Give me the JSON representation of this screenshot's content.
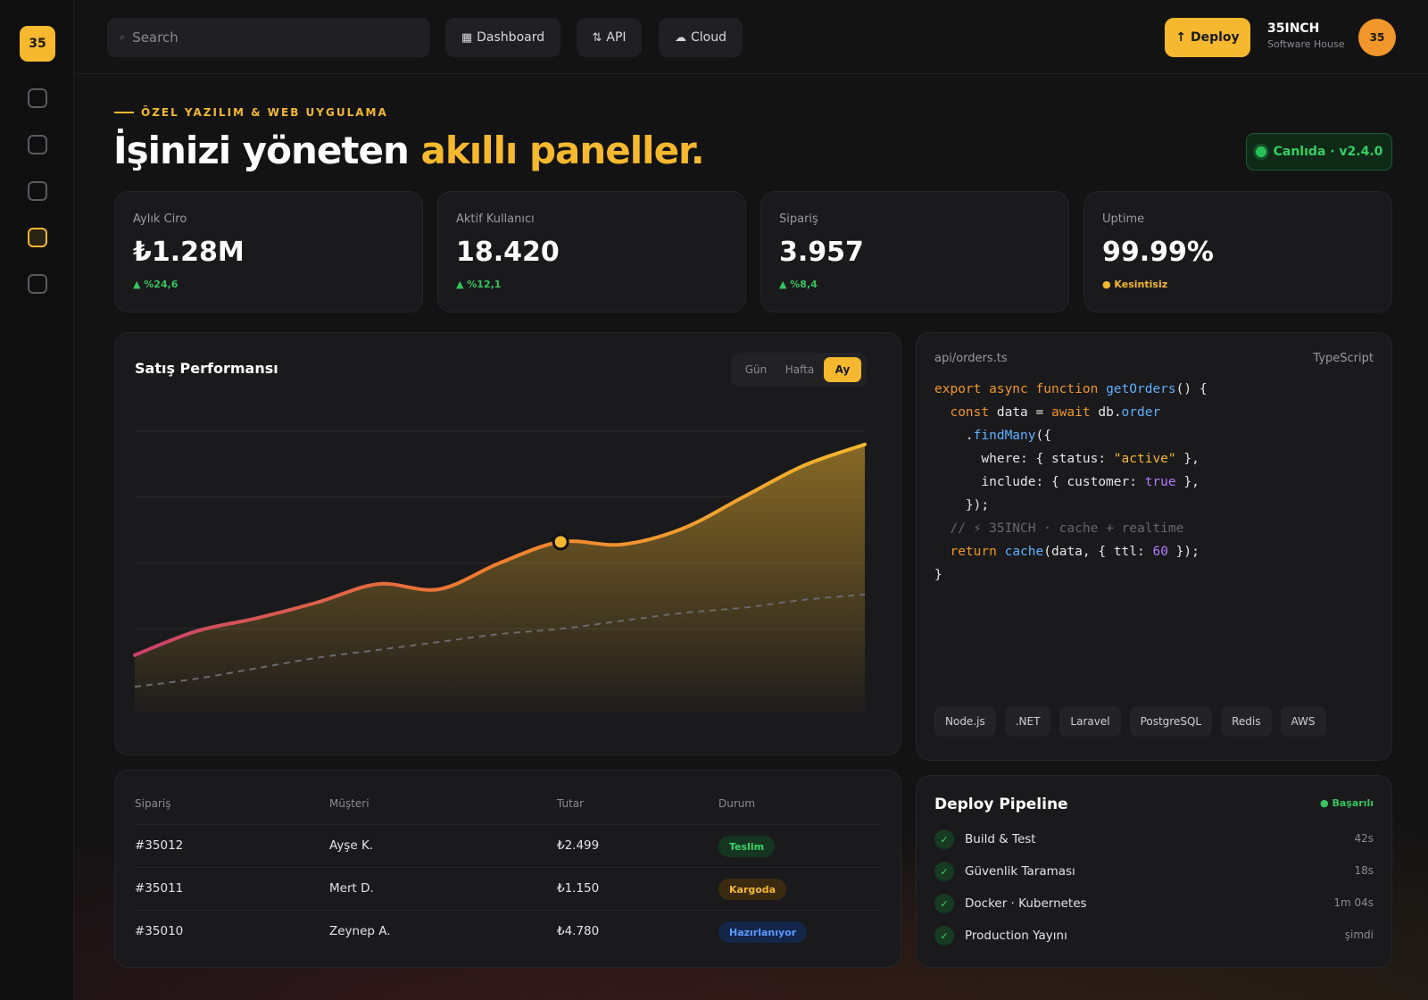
{
  "sidebar": {
    "logo": "35"
  },
  "topbar": {
    "search_placeholder": "Search",
    "nav": [
      {
        "label": "Dashboard",
        "glyph": "▦"
      },
      {
        "label": "API",
        "glyph": "⇅"
      },
      {
        "label": "Cloud",
        "glyph": "☁"
      }
    ],
    "deploy_label": "↑ Deploy",
    "brand_name": "35INCH",
    "brand_sub": "Software House",
    "avatar": "35"
  },
  "hero": {
    "eyebrow": "ÖZEL YAZILIM & WEB UYGULAMA",
    "title_main": "İşinizi yöneten ",
    "title_accent": "akıllı paneller.",
    "live_badge": "Canlıda · v2.4.0"
  },
  "stats": [
    {
      "label": "Aylık Ciro",
      "value": "₺1.28M",
      "delta": "▲ %24,6",
      "tone": "green"
    },
    {
      "label": "Aktif Kullanıcı",
      "value": "18.420",
      "delta": "▲ %12,1",
      "tone": "green"
    },
    {
      "label": "Sipariş",
      "value": "3.957",
      "delta": "▲ %8,4",
      "tone": "green"
    },
    {
      "label": "Uptime",
      "value": "99.99%",
      "delta": "● Kesintisiz",
      "tone": "amber"
    }
  ],
  "chart": {
    "title": "Satış Performansı",
    "ranges": [
      "Gün",
      "Hafta",
      "Ay"
    ],
    "active_range": "Ay"
  },
  "chart_data": {
    "type": "area",
    "title": "Satış Performansı",
    "xlabel": "",
    "ylabel": "",
    "grid": true,
    "ylim": [
      0,
      100
    ],
    "x": [
      0,
      1,
      2,
      3,
      4,
      5,
      6,
      7,
      8,
      9,
      10,
      11,
      12
    ],
    "series": [
      {
        "values": [
          15,
          24,
          29,
          35,
          42,
          40,
          50,
          58,
          57,
          63,
          75,
          87,
          95
        ],
        "style": "area-gradient"
      },
      {
        "values": [
          3,
          6,
          10,
          14,
          17,
          20,
          23,
          25,
          28,
          31,
          33,
          36,
          38
        ],
        "style": "dashed"
      }
    ],
    "highlight_point_index": 7
  },
  "code": {
    "filename": "api/orders.ts",
    "language": "TypeScript",
    "tags": [
      "Node.js",
      ".NET",
      "Laravel",
      "PostgreSQL",
      "Redis",
      "AWS"
    ]
  },
  "table": {
    "headers": [
      "Sipariş",
      "Müşteri",
      "Tutar",
      "Durum"
    ],
    "rows": [
      {
        "id": "#35012",
        "customer": "Ayşe K.",
        "amount": "₺2.499",
        "status": "Teslim",
        "tone": "green"
      },
      {
        "id": "#35011",
        "customer": "Mert D.",
        "amount": "₺1.150",
        "status": "Kargoda",
        "tone": "amber"
      },
      {
        "id": "#35010",
        "customer": "Zeynep A.",
        "amount": "₺4.780",
        "status": "Hazırlanıyor",
        "tone": "blue"
      }
    ]
  },
  "pipeline": {
    "title": "Deploy Pipeline",
    "status": "● Başarılı",
    "steps": [
      {
        "name": "Build & Test",
        "time": "42s"
      },
      {
        "name": "Güvenlik Taraması",
        "time": "18s"
      },
      {
        "name": "Docker · Kubernetes",
        "time": "1m 04s"
      },
      {
        "name": "Production Yayını",
        "time": "şimdi"
      }
    ]
  }
}
